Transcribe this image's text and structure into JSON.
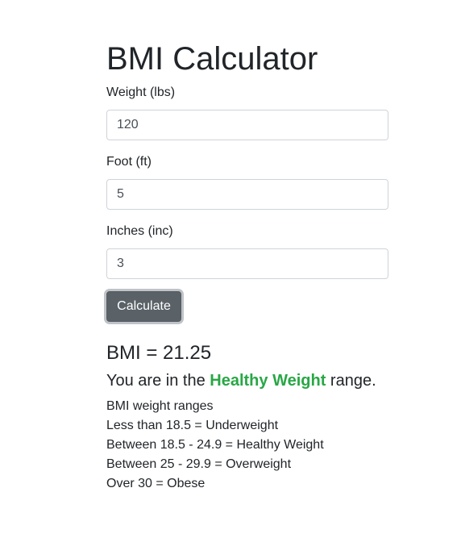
{
  "page": {
    "title": "BMI Calculator"
  },
  "form": {
    "weight": {
      "label": "Weight (lbs)",
      "value": "120"
    },
    "foot": {
      "label": "Foot (ft)",
      "value": "5"
    },
    "inches": {
      "label": "Inches (inc)",
      "value": "3"
    },
    "calculate_label": "Calculate"
  },
  "result": {
    "bmi_label": "BMI",
    "bmi_equals": "=",
    "bmi_value": "21.25",
    "range_prefix": "You are in the",
    "range_category": "Healthy Weight",
    "range_suffix": "range.",
    "category_color": "#28a745"
  },
  "ranges": {
    "heading": "BMI weight ranges",
    "items": [
      "Less than 18.5 = Underweight",
      "Between 18.5 - 24.9 = Healthy Weight",
      "Between 25 - 29.9 = Overweight",
      "Over 30 = Obese"
    ]
  }
}
